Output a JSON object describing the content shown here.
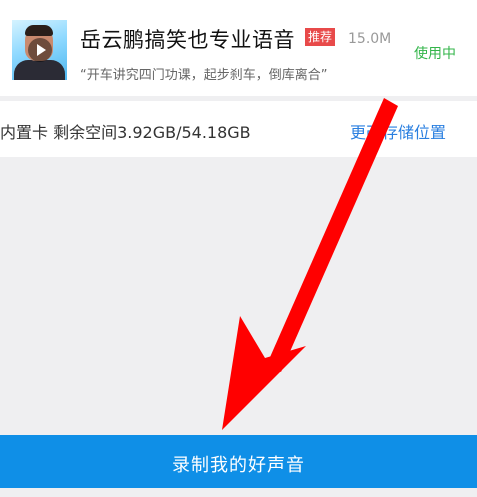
{
  "voice_item": {
    "title": "岳云鹏搞笑也专业语音",
    "badge": "推荐",
    "size": "15.0M",
    "status": "使用中",
    "description": "“开车讲究四门功课，起步刹车，倒库离合”"
  },
  "storage": {
    "info": "内置卡 剩余空间3.92GB/54.18GB",
    "change_label": "更改存储位置"
  },
  "record_button": {
    "label": "录制我的好声音"
  },
  "colors": {
    "primary": "#0f8fe7",
    "status_green": "#33b54a",
    "badge_red": "#e84a4a",
    "annotation_arrow": "#ff0000"
  },
  "icons": {
    "thumbnail": "play-icon"
  }
}
